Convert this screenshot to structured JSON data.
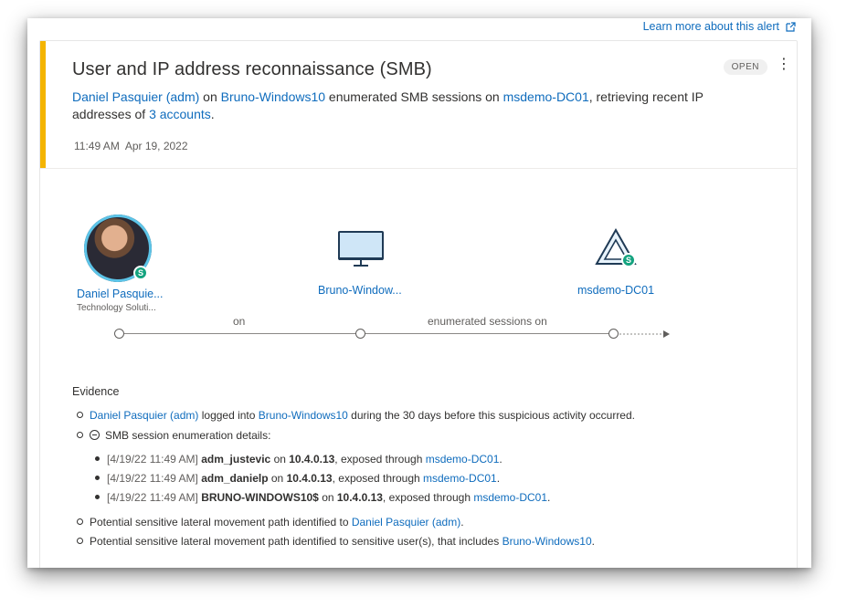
{
  "learn_more": "Learn more about this alert",
  "alert": {
    "title": "User and IP address reconnaissance (SMB)",
    "status": "OPEN",
    "more_icon": "more-vertical-icon",
    "desc": {
      "user": "Daniel Pasquier (adm)",
      "on": " on ",
      "device": "Bruno-Windows10",
      "enumerated": " enumerated SMB sessions on ",
      "dc": "msdemo-DC01",
      "retrieving": ", retrieving recent IP addresses of ",
      "accounts": "3 accounts",
      "end": "."
    },
    "time": "11:49 AM",
    "date": "Apr 19, 2022",
    "accent_color": "#f4b400"
  },
  "entities": {
    "user": {
      "name": "Daniel Pasquie...",
      "sub": "Technology Soluti...",
      "badge": "S"
    },
    "device": {
      "name": "Bruno-Window..."
    },
    "dc": {
      "name": "msdemo-DC01",
      "badge": "S"
    }
  },
  "timeline": {
    "label1": "on",
    "label2": "enumerated sessions on"
  },
  "evidence": {
    "title": "Evidence",
    "line1": {
      "user": "Daniel Pasquier (adm)",
      "mid": " logged into ",
      "device": "Bruno-Windows10",
      "end": " during the 30 days before this suspicious activity occurred."
    },
    "line2": "SMB session enumeration details:",
    "details": [
      {
        "ts": "[4/19/22 11:49 AM] ",
        "account": "adm_justevic",
        "on": " on ",
        "ip": "10.4.0.13",
        "mid": ", exposed through ",
        "dc": "msdemo-DC01",
        "end": "."
      },
      {
        "ts": "[4/19/22 11:49 AM] ",
        "account": "adm_danielp",
        "on": " on ",
        "ip": "10.4.0.13",
        "mid": ", exposed through ",
        "dc": "msdemo-DC01",
        "end": "."
      },
      {
        "ts": "[4/19/22 11:49 AM] ",
        "account": "BRUNO-WINDOWS10$",
        "on": " on ",
        "ip": "10.4.0.13",
        "mid": ", exposed through ",
        "dc": "msdemo-DC01",
        "end": "."
      }
    ],
    "line3": {
      "text": "Potential sensitive lateral movement path identified to ",
      "link": "Daniel Pasquier (adm)",
      "end": "."
    },
    "line4": {
      "text": "Potential sensitive lateral movement path identified to sensitive user(s), that includes ",
      "link": "Bruno-Windows10",
      "end": "."
    }
  }
}
